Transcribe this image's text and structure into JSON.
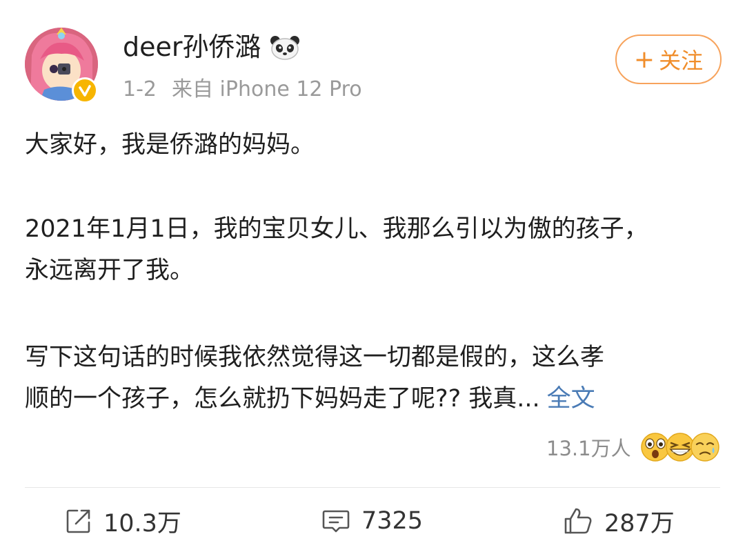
{
  "post": {
    "username": "deer孙侨潞",
    "date": "1-2",
    "source": "来自 iPhone 12 Pro",
    "follow_label": "关注",
    "follow_plus": "+",
    "paragraphs": [
      [
        "大家好，我是侨潞的妈妈。"
      ],
      [
        "2021年1月1日，我的宝贝女儿、我那么引以为傲的孩子，",
        "永远离开了我。"
      ],
      [
        "写下这句话的时候我依然觉得这一切都是假的，这么孝",
        "顺的一个孩子，怎么就扔下妈妈走了呢?? 我真..."
      ]
    ],
    "full_text_link": "全文",
    "reaction_count": "13.1万人",
    "reactions": [
      "surprised-emoji",
      "laugh-emoji",
      "sad-emoji"
    ],
    "actions": {
      "repost_count": "10.3万",
      "comment_count": "7325",
      "like_count": "287万"
    }
  },
  "icons": {
    "avatar": "anime-girl-avatar",
    "badge": "verified-badge-icon",
    "panda": "panda-icon",
    "repost": "repost-icon",
    "comment": "comment-icon",
    "like": "thumbs-up-icon"
  },
  "colors": {
    "accent_follow": "#f08d2a",
    "link": "#4a7bb5",
    "meta_gray": "#9a9a9a",
    "verified": "#f7b500"
  }
}
